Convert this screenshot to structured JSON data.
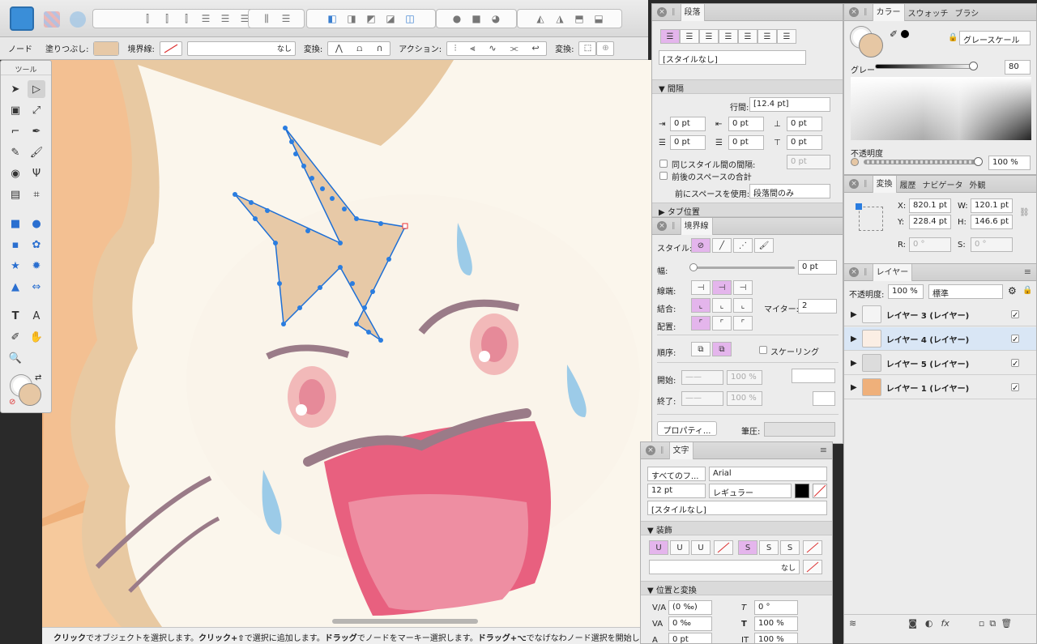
{
  "toolbar": {
    "buttons": [
      "|‖",
      "‖|",
      "≡",
      "≡",
      "≡",
      "≡",
      "|‖|",
      "⊟",
      "⊕",
      "⊖",
      "⊗",
      "⊘",
      "⊙",
      "◐",
      "◑",
      "◒",
      "◭",
      "◮",
      "⬒",
      "⬓"
    ]
  },
  "context": {
    "node_label": "ノード",
    "fill_label": "塗りつぶし:",
    "stroke_label": "境界線:",
    "stroke_value": "なし",
    "transform_label": "変換:",
    "action_label": "アクション:",
    "convert_label": "変換:",
    "fill_color": "#e7c9a7"
  },
  "tools_panel": {
    "title": "ツール",
    "fill_color": "#e6c7a4"
  },
  "status": {
    "parts": [
      {
        "b": "クリック",
        "t": "でオブジェクトを選択します。"
      },
      {
        "b": "クリック+⇧",
        "t": "で選択に追加します。"
      },
      {
        "b": "ドラッグ",
        "t": "でノードをマーキー選択します。"
      },
      {
        "b": "ドラッグ+⌥",
        "t": "でなげなわノード選択を開始します。"
      },
      {
        "b": "クリッ",
        "t": ""
      }
    ]
  },
  "paragraph": {
    "title": "段落",
    "style": "[スタイルなし]",
    "spacing_section": "間隔",
    "line_spacing_label": "行間:",
    "line_spacing_value": "[12.4 pt]",
    "indent_values": [
      "0 pt",
      "0 pt",
      "0 pt",
      "0 pt",
      "0 pt",
      "0 pt"
    ],
    "same_style_label": "同じスタイル間の間隔:",
    "same_style_value": "0 pt",
    "sum_label": "前後のスペースの合計",
    "apply_label": "前にスペースを使用:",
    "apply_value": "段落間のみ",
    "tab_section": "タブ位置"
  },
  "stroke": {
    "title": "境界線",
    "style_label": "スタイル:",
    "width_label": "幅:",
    "width_value": "0 pt",
    "cap_label": "線端:",
    "join_label": "結合:",
    "miter_label": "マイター:",
    "miter_value": "2",
    "align_label": "配置:",
    "order_label": "順序:",
    "scaling_label": "スケーリング",
    "start_label": "開始:",
    "end_label": "終了:",
    "start_pct": "100 %",
    "end_pct": "100 %",
    "props_button": "プロパティ...",
    "pressure_label": "筆圧:"
  },
  "character": {
    "title": "文字",
    "font_scope": "すべてのフ...",
    "font_name": "Arial",
    "size": "12 pt",
    "weight": "レギュラー",
    "style": "[スタイルなし]",
    "decor_section": "装飾",
    "decor_buttons": [
      "U",
      "U",
      "U",
      "S",
      "S",
      "S"
    ],
    "decor_value": "なし",
    "pos_section": "位置と変換",
    "rows": [
      {
        "l": "V/A",
        "v": "(0 ‰)",
        "l2": "T",
        "v2": "0 °"
      },
      {
        "l": "VA",
        "v": "0 ‰",
        "l2": "T",
        "v2": "100 %"
      },
      {
        "l": "A",
        "v": "0 pt",
        "l2": "IT",
        "v2": "100 %"
      }
    ]
  },
  "color": {
    "tabs": [
      "カラー",
      "スウォッチ",
      "ブラシ"
    ],
    "mode": "グレースケール",
    "gray_label": "グレー",
    "gray_value": "80",
    "opacity_label": "不透明度",
    "opacity_value": "100 %",
    "swatch": "#e6c7a4"
  },
  "transform": {
    "tabs": [
      "変換",
      "履歴",
      "ナビゲータ",
      "外観"
    ],
    "x_label": "X:",
    "x": "820.1 pt",
    "y_label": "Y:",
    "y": "228.4 pt",
    "w_label": "W:",
    "w": "120.1 pt",
    "h_label": "H:",
    "h": "146.6 pt",
    "r_label": "R:",
    "r": "0 °",
    "s_label": "S:",
    "s": "0 °"
  },
  "layers": {
    "title": "レイヤー",
    "opacity_label": "不透明度:",
    "opacity_value": "100 %",
    "blend": "標準",
    "items": [
      {
        "name": "レイヤー 3",
        "type": "(レイヤー)"
      },
      {
        "name": "レイヤー 4",
        "type": "(レイヤー)"
      },
      {
        "name": "レイヤー 5",
        "type": "(レイヤー)"
      },
      {
        "name": "レイヤー 1",
        "type": "(レイヤー)"
      }
    ]
  }
}
